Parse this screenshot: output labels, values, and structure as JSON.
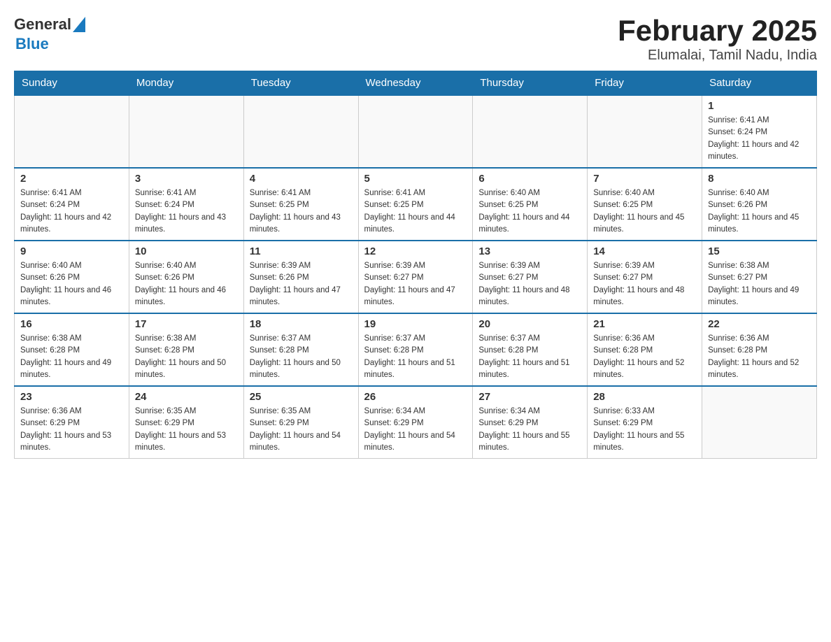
{
  "header": {
    "logo_general": "General",
    "logo_blue": "Blue",
    "title": "February 2025",
    "subtitle": "Elumalai, Tamil Nadu, India"
  },
  "days_of_week": [
    "Sunday",
    "Monday",
    "Tuesday",
    "Wednesday",
    "Thursday",
    "Friday",
    "Saturday"
  ],
  "weeks": [
    {
      "days": [
        {
          "date": "",
          "info": ""
        },
        {
          "date": "",
          "info": ""
        },
        {
          "date": "",
          "info": ""
        },
        {
          "date": "",
          "info": ""
        },
        {
          "date": "",
          "info": ""
        },
        {
          "date": "",
          "info": ""
        },
        {
          "date": "1",
          "info": "Sunrise: 6:41 AM\nSunset: 6:24 PM\nDaylight: 11 hours and 42 minutes."
        }
      ]
    },
    {
      "days": [
        {
          "date": "2",
          "info": "Sunrise: 6:41 AM\nSunset: 6:24 PM\nDaylight: 11 hours and 42 minutes."
        },
        {
          "date": "3",
          "info": "Sunrise: 6:41 AM\nSunset: 6:24 PM\nDaylight: 11 hours and 43 minutes."
        },
        {
          "date": "4",
          "info": "Sunrise: 6:41 AM\nSunset: 6:25 PM\nDaylight: 11 hours and 43 minutes."
        },
        {
          "date": "5",
          "info": "Sunrise: 6:41 AM\nSunset: 6:25 PM\nDaylight: 11 hours and 44 minutes."
        },
        {
          "date": "6",
          "info": "Sunrise: 6:40 AM\nSunset: 6:25 PM\nDaylight: 11 hours and 44 minutes."
        },
        {
          "date": "7",
          "info": "Sunrise: 6:40 AM\nSunset: 6:25 PM\nDaylight: 11 hours and 45 minutes."
        },
        {
          "date": "8",
          "info": "Sunrise: 6:40 AM\nSunset: 6:26 PM\nDaylight: 11 hours and 45 minutes."
        }
      ]
    },
    {
      "days": [
        {
          "date": "9",
          "info": "Sunrise: 6:40 AM\nSunset: 6:26 PM\nDaylight: 11 hours and 46 minutes."
        },
        {
          "date": "10",
          "info": "Sunrise: 6:40 AM\nSunset: 6:26 PM\nDaylight: 11 hours and 46 minutes."
        },
        {
          "date": "11",
          "info": "Sunrise: 6:39 AM\nSunset: 6:26 PM\nDaylight: 11 hours and 47 minutes."
        },
        {
          "date": "12",
          "info": "Sunrise: 6:39 AM\nSunset: 6:27 PM\nDaylight: 11 hours and 47 minutes."
        },
        {
          "date": "13",
          "info": "Sunrise: 6:39 AM\nSunset: 6:27 PM\nDaylight: 11 hours and 48 minutes."
        },
        {
          "date": "14",
          "info": "Sunrise: 6:39 AM\nSunset: 6:27 PM\nDaylight: 11 hours and 48 minutes."
        },
        {
          "date": "15",
          "info": "Sunrise: 6:38 AM\nSunset: 6:27 PM\nDaylight: 11 hours and 49 minutes."
        }
      ]
    },
    {
      "days": [
        {
          "date": "16",
          "info": "Sunrise: 6:38 AM\nSunset: 6:28 PM\nDaylight: 11 hours and 49 minutes."
        },
        {
          "date": "17",
          "info": "Sunrise: 6:38 AM\nSunset: 6:28 PM\nDaylight: 11 hours and 50 minutes."
        },
        {
          "date": "18",
          "info": "Sunrise: 6:37 AM\nSunset: 6:28 PM\nDaylight: 11 hours and 50 minutes."
        },
        {
          "date": "19",
          "info": "Sunrise: 6:37 AM\nSunset: 6:28 PM\nDaylight: 11 hours and 51 minutes."
        },
        {
          "date": "20",
          "info": "Sunrise: 6:37 AM\nSunset: 6:28 PM\nDaylight: 11 hours and 51 minutes."
        },
        {
          "date": "21",
          "info": "Sunrise: 6:36 AM\nSunset: 6:28 PM\nDaylight: 11 hours and 52 minutes."
        },
        {
          "date": "22",
          "info": "Sunrise: 6:36 AM\nSunset: 6:28 PM\nDaylight: 11 hours and 52 minutes."
        }
      ]
    },
    {
      "days": [
        {
          "date": "23",
          "info": "Sunrise: 6:36 AM\nSunset: 6:29 PM\nDaylight: 11 hours and 53 minutes."
        },
        {
          "date": "24",
          "info": "Sunrise: 6:35 AM\nSunset: 6:29 PM\nDaylight: 11 hours and 53 minutes."
        },
        {
          "date": "25",
          "info": "Sunrise: 6:35 AM\nSunset: 6:29 PM\nDaylight: 11 hours and 54 minutes."
        },
        {
          "date": "26",
          "info": "Sunrise: 6:34 AM\nSunset: 6:29 PM\nDaylight: 11 hours and 54 minutes."
        },
        {
          "date": "27",
          "info": "Sunrise: 6:34 AM\nSunset: 6:29 PM\nDaylight: 11 hours and 55 minutes."
        },
        {
          "date": "28",
          "info": "Sunrise: 6:33 AM\nSunset: 6:29 PM\nDaylight: 11 hours and 55 minutes."
        },
        {
          "date": "",
          "info": ""
        }
      ]
    }
  ]
}
